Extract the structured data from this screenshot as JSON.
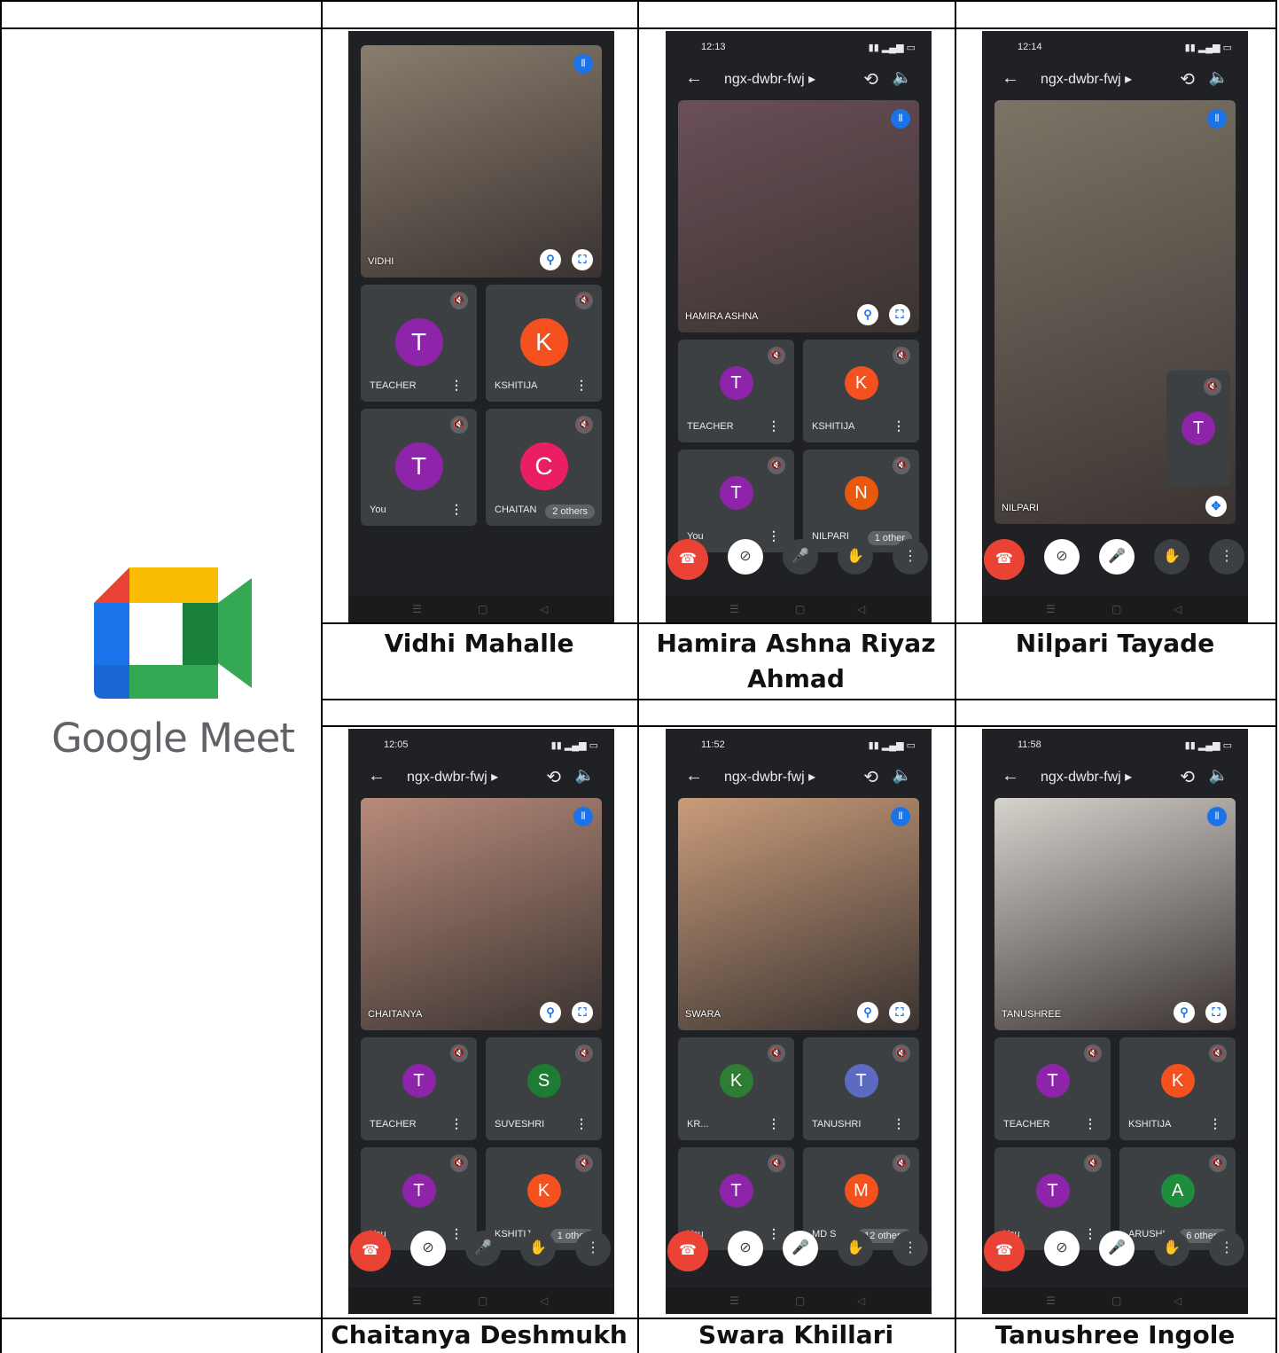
{
  "logo": {
    "text": "Google Meet",
    "icon": "google-meet-icon"
  },
  "meeting_code": "ngx-dwbr-fwj ▸",
  "phones": [
    {
      "caption": "Vidhi Mahalle",
      "time": "",
      "main": "VIDHI",
      "tiles": [
        {
          "name": "TEACHER",
          "letter": "T",
          "color": "#8e24aa"
        },
        {
          "name": "KSHITIJA",
          "letter": "K",
          "color": "#f4511e"
        },
        {
          "name": "You",
          "letter": "T",
          "color": "#8e24aa"
        },
        {
          "name": "CHAITAN",
          "letter": "C",
          "color": "#e91e63",
          "more": "2 others"
        }
      ]
    },
    {
      "caption": "Hamira Ashna Riyaz Ahmad",
      "time": "12:13",
      "main": "HAMIRA ASHNA",
      "tiles": [
        {
          "name": "TEACHER",
          "letter": "T",
          "color": "#8e24aa"
        },
        {
          "name": "KSHITIJA",
          "letter": "K",
          "color": "#f4511e"
        },
        {
          "name": "You",
          "letter": "T",
          "color": "#8e24aa"
        },
        {
          "name": "NILPARI",
          "letter": "N",
          "color": "#e8590c",
          "more": "1 other"
        }
      ]
    },
    {
      "caption": "Nilpari Tayade",
      "time": "12:14",
      "main": "NILPARI",
      "pip": "T"
    },
    {
      "caption": "Chaitanya Deshmukh",
      "time": "12:05",
      "main": "CHAITANYA",
      "tiles": [
        {
          "name": "TEACHER",
          "letter": "T",
          "color": "#8e24aa"
        },
        {
          "name": "SUVESHRI",
          "letter": "S",
          "color": "#1e7b34"
        },
        {
          "name": "You",
          "letter": "T",
          "color": "#8e24aa"
        },
        {
          "name": "KSHITIJ",
          "letter": "K",
          "color": "#f4511e",
          "more": "1 other"
        }
      ]
    },
    {
      "caption": "Swara Khillari",
      "time": "11:52",
      "main": "SWARA",
      "tiles": [
        {
          "name": "KR...",
          "letter": "K",
          "color": "#2e7d32"
        },
        {
          "name": "TANUSHRI",
          "letter": "T",
          "color": "#5c6bc0"
        },
        {
          "name": "You",
          "letter": "T",
          "color": "#8e24aa"
        },
        {
          "name": "MD S",
          "letter": "M",
          "color": "#f4511e",
          "more": "12 others"
        }
      ]
    },
    {
      "caption": "Tanushree Ingole",
      "time": "11:58",
      "main": "TANUSHREE",
      "tiles": [
        {
          "name": "TEACHER",
          "letter": "T",
          "color": "#8e24aa"
        },
        {
          "name": "KSHITIJA",
          "letter": "K",
          "color": "#f4511e"
        },
        {
          "name": "You",
          "letter": "T",
          "color": "#8e24aa"
        },
        {
          "name": "ARUSHI",
          "letter": "A",
          "color": "#1e8e3e",
          "more": "6 others"
        }
      ]
    }
  ]
}
